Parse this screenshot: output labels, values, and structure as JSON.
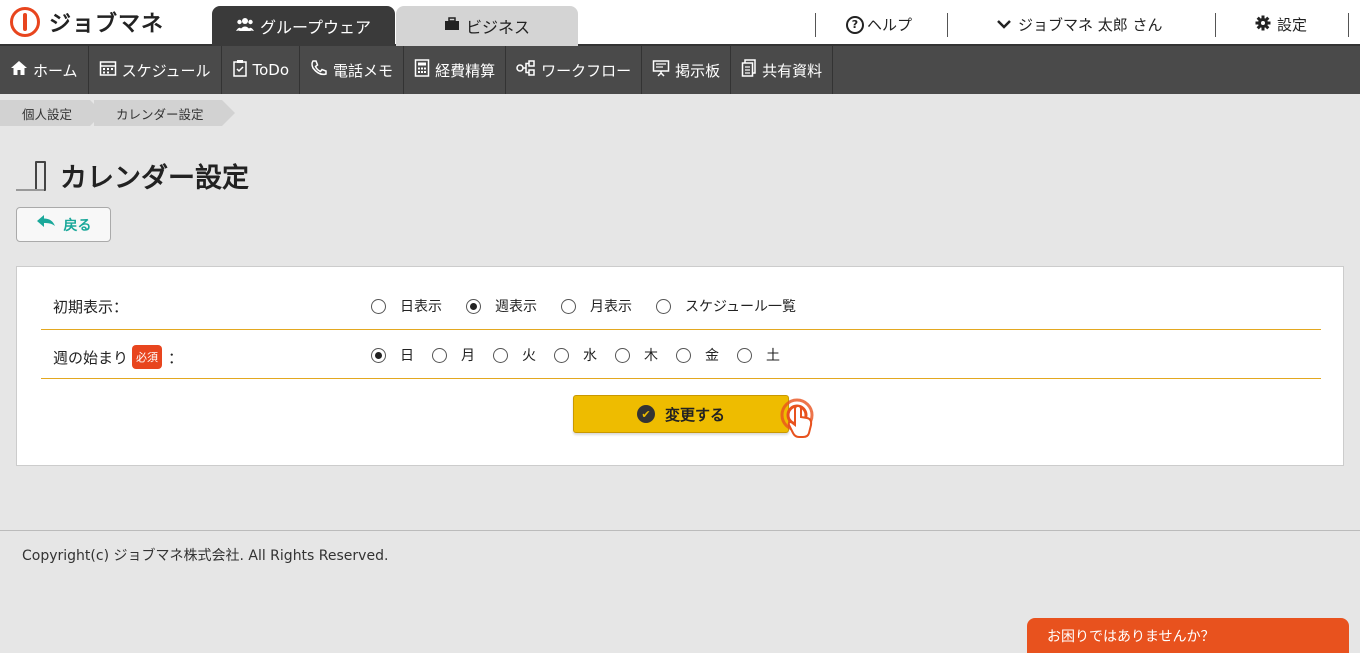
{
  "logo": {
    "text": "ジョブマネ"
  },
  "tabs": [
    {
      "label": "グループウェア",
      "icon": "users-icon"
    },
    {
      "label": "ビジネス",
      "icon": "briefcase-icon"
    }
  ],
  "top_links": {
    "help": "ヘルプ",
    "user": "ジョブマネ 太郎 さん",
    "settings": "設定"
  },
  "menu": [
    {
      "label": "ホーム",
      "icon": "home-icon"
    },
    {
      "label": "スケジュール",
      "icon": "calendar-icon"
    },
    {
      "label": "ToDo",
      "icon": "clipboard-icon"
    },
    {
      "label": "電話メモ",
      "icon": "phone-icon"
    },
    {
      "label": "経費精算",
      "icon": "calculator-icon"
    },
    {
      "label": "ワークフロー",
      "icon": "workflow-icon"
    },
    {
      "label": "掲示板",
      "icon": "board-icon"
    },
    {
      "label": "共有資料",
      "icon": "documents-icon"
    }
  ],
  "breadcrumb": [
    "個人設定",
    "カレンダー設定"
  ],
  "page_title": "カレンダー設定",
  "back_button": "戻る",
  "form": {
    "initial_display": {
      "label": "初期表示：",
      "options": [
        "日表示",
        "週表示",
        "月表示",
        "スケジュール一覧"
      ],
      "selected": "週表示"
    },
    "week_start": {
      "label": "週の始まり",
      "required": "必須",
      "colon": "：",
      "options": [
        "日",
        "月",
        "火",
        "水",
        "木",
        "金",
        "土"
      ],
      "selected": "日"
    },
    "submit": "変更する"
  },
  "footer": {
    "copyright": "Copyright(c) ジョブマネ株式会社. All Rights Reserved."
  },
  "help_widget": "お困りではありませんか？",
  "colors": {
    "brand": "#e8451e",
    "accent": "#eebc00",
    "menu_bg": "#4a4a4a",
    "row_divider": "#e3a820"
  }
}
